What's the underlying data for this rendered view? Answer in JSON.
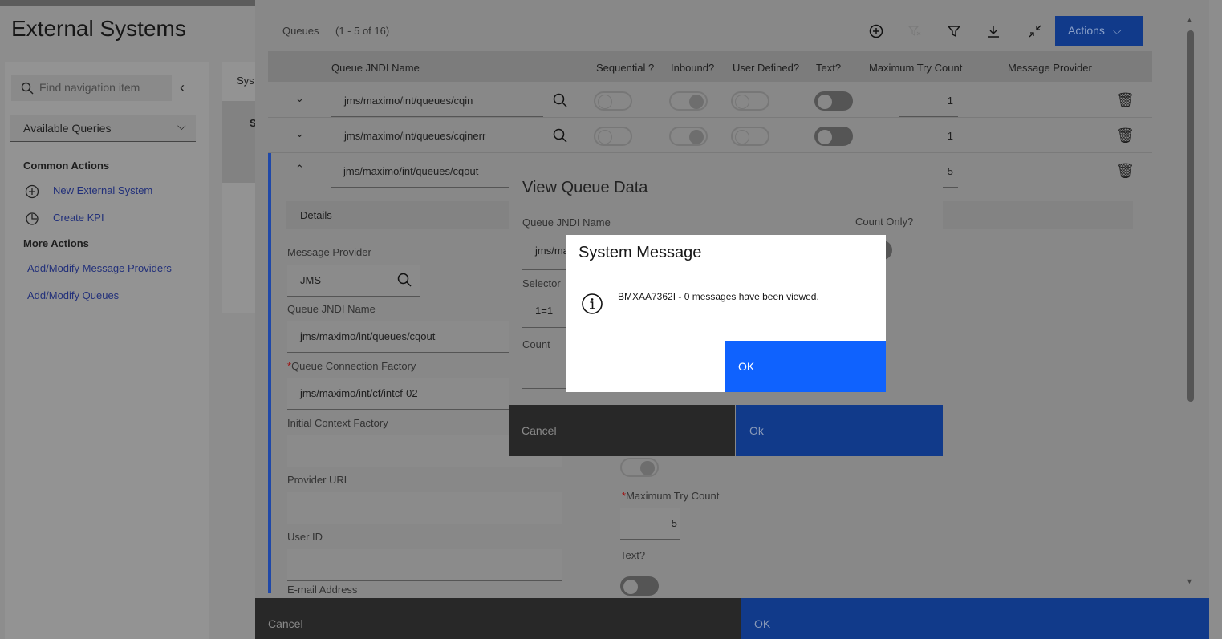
{
  "app": {
    "title": "External Systems"
  },
  "sidebar": {
    "search_placeholder": "Find navigation item",
    "queries_label": "Available Queries",
    "common_actions": "Common Actions",
    "common": [
      {
        "label": "New External System",
        "icon": "add-circle-icon"
      },
      {
        "label": "Create KPI",
        "icon": "kpi-icon"
      }
    ],
    "more_actions": "More Actions",
    "more": [
      {
        "label": "Add/Modify Message Providers"
      },
      {
        "label": "Add/Modify Queues"
      }
    ]
  },
  "main": {
    "tab_fragment": "Sys",
    "section_fragment": "S"
  },
  "queues": {
    "label": "Queues",
    "count": "(1 - 5 of 16)",
    "actions_label": "Actions",
    "columns": [
      "Queue JNDI Name",
      "Sequential ?",
      "Inbound?",
      "User Defined?",
      "Text?",
      "Maximum Try Count",
      "Message Provider"
    ],
    "rows": [
      {
        "name": "jms/maximo/int/queues/cqin",
        "sequential": false,
        "inbound": true,
        "user_defined": false,
        "text": false,
        "max_try": "1",
        "provider": ""
      },
      {
        "name": "jms/maximo/int/queues/cqinerr",
        "sequential": false,
        "inbound": true,
        "user_defined": false,
        "text": false,
        "max_try": "1",
        "provider": ""
      },
      {
        "name": "jms/maximo/int/queues/cqout",
        "sequential": false,
        "inbound": false,
        "user_defined": true,
        "text": false,
        "max_try": "5",
        "provider": ""
      }
    ]
  },
  "details": {
    "header": "Details",
    "message_provider_label": "Message Provider",
    "message_provider": "JMS",
    "queue_jndi_label": "Queue JNDI Name",
    "queue_jndi": "jms/maximo/int/queues/cqout",
    "qcf_label": "Queue Connection Factory",
    "qcf": "jms/maximo/int/cf/intcf-02",
    "icf_label": "Initial Context Factory",
    "provider_url_label": "Provider URL",
    "user_id_label": "User ID",
    "email_label": "E-mail Address",
    "max_try_label": "Maximum Try Count",
    "max_try": "5",
    "text_label": "Text?"
  },
  "footer": {
    "cancel": "Cancel",
    "ok": "OK"
  },
  "view_queue": {
    "title": "View Queue Data",
    "jndi_label": "Queue JNDI Name",
    "jndi_value": "jms/ma",
    "count_only_label": "Count Only?",
    "selector_label": "Selector",
    "selector_value": "1=1",
    "count_label": "Count",
    "cancel": "Cancel",
    "ok": "Ok"
  },
  "system_message": {
    "title": "System Message",
    "message": "BMXAA7362I - 0 messages have been viewed.",
    "ok": "OK",
    "icon": "info-icon"
  },
  "colors": {
    "primary": "#0f62fe",
    "primary_dimmed": "#113a8a",
    "dark_button": "#282828"
  }
}
